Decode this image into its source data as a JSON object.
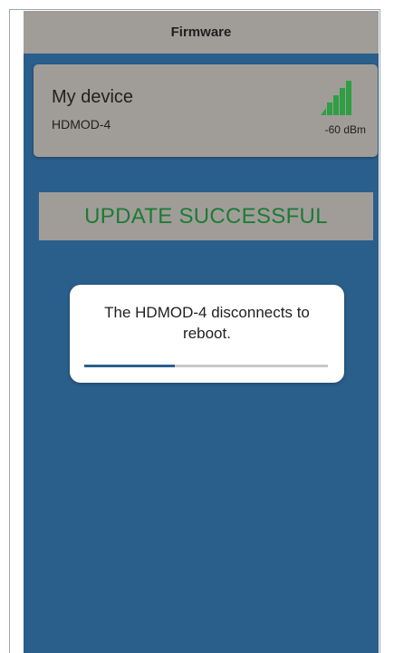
{
  "header": {
    "title": "Firmware"
  },
  "device": {
    "name": "My device",
    "model": "HDMOD-4",
    "rssi": "-60 dBm",
    "signal_bars": 5,
    "signal_color": "#2f9e44"
  },
  "status": {
    "message": "UPDATE SUCCESSFUL",
    "color": "#1f7a34"
  },
  "dialog": {
    "message": "The HDMOD-4 disconnects to reboot.",
    "progress": 0.37
  },
  "colors": {
    "background": "#2a5f8c",
    "card": "#a09d99"
  }
}
